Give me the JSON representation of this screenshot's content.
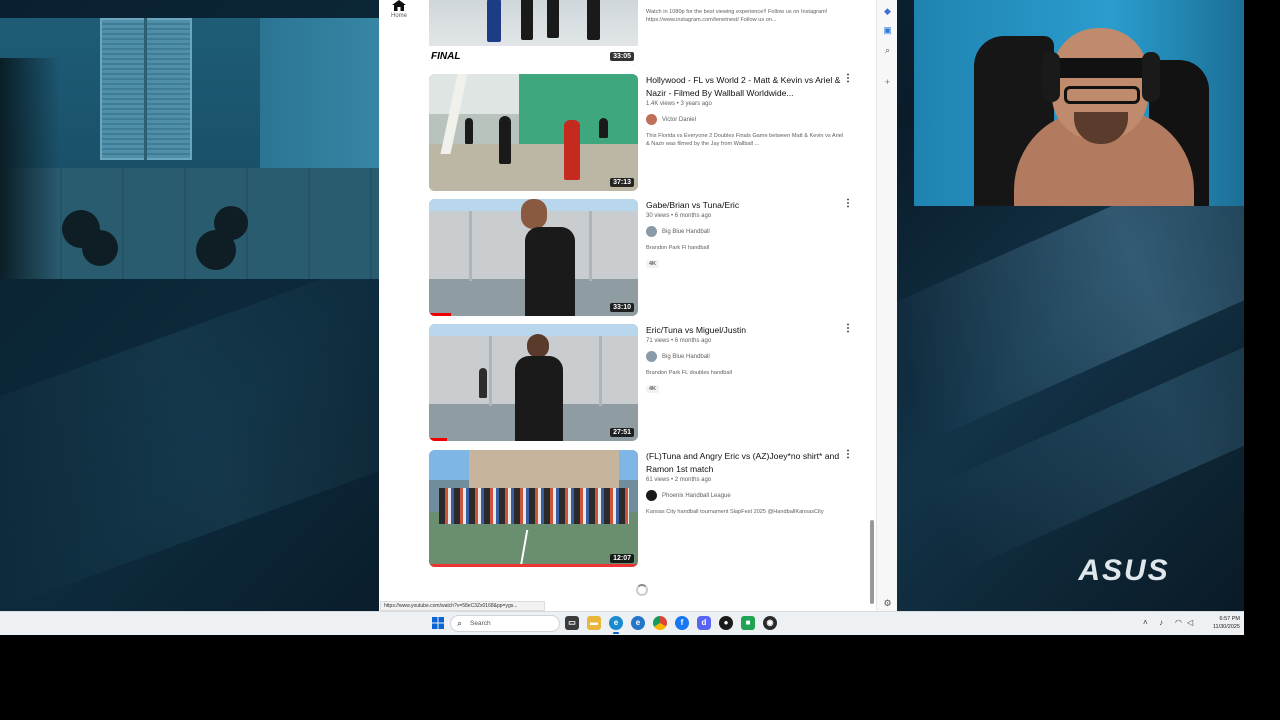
{
  "browser": {
    "left_rail": {
      "home_label": "Home",
      "home_icon": "home-icon"
    },
    "videos": [
      {
        "duration": "33:05",
        "description_lines": [
          "Watch in 1080p for the best viewing experience!! Follow us on Instagram!",
          "https://www.instagram.com/tenetnest/ Follow us on..."
        ],
        "thumb_overlay_text": "FINAL"
      },
      {
        "title": "Hollywood - FL vs World 2 - Matt & Kevin vs Ariel & Nazir - Filmed By Wallball Worldwide...",
        "stats": "1.4K views • 3 years ago",
        "channel": "Victor Daniel",
        "avatar_color": "#c0705a",
        "description": "This Florida vs Everyone 2 Doubles Finals Game between Matt & Kevin vs Ariel & Nazir was filmed by the Jay from Wallball ...",
        "duration": "37:13"
      },
      {
        "title": "Gabe/Brian vs Tuna/Eric",
        "stats": "30 views • 6 months ago",
        "channel": "Big Blue Handball",
        "avatar_color": "#8a9aa6",
        "description": "Brandon Park Fl handball",
        "badge": "4K",
        "duration": "33:10"
      },
      {
        "title": "Eric/Tuna vs Miguel/Justin",
        "stats": "71 views • 6 months ago",
        "channel": "Big Blue Handball",
        "avatar_color": "#8a9aa6",
        "description": "Brandon Park FL doubles handball",
        "badge": "4K",
        "duration": "27:51"
      },
      {
        "title": "(FL)Tuna and Angry Eric vs (AZ)Joey*no shirt* and Ramon 1st match",
        "stats": "61 views • 2 months ago",
        "channel": "Phoenix Handball League",
        "avatar_color": "#1a1a1a",
        "description": "Kansas City handball tournament SlapFest 2025 @HandballKansasCity",
        "duration": "12:07"
      }
    ],
    "status_url": "https://www.youtube.com/watch?v=58eC3Zx0168&pp=ygs...",
    "side_panel_icons": [
      "copilot-icon",
      "collections-icon",
      "search-icon",
      "add-icon",
      "settings-icon"
    ],
    "kebab_glyph": "⋮"
  },
  "taskbar": {
    "search_placeholder": "Search",
    "apps": [
      "task-view-icon",
      "file-explorer-icon",
      "edge-icon",
      "edge-dev-icon",
      "chrome-icon",
      "facebook-icon",
      "discord-icon",
      "obs-icon",
      "app-green-icon",
      "app-dark-icon"
    ],
    "clock_time": "6:57 PM",
    "clock_date": "11/30/2025"
  },
  "desktop": {
    "brand_logo": "ASUS"
  },
  "colors": {
    "accent": "#e00000",
    "taskbar_bg": "#eef1f4"
  }
}
